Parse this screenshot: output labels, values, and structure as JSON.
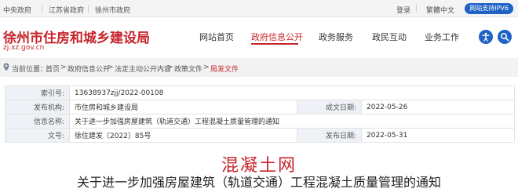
{
  "topbar": {
    "links": [
      "中央政府",
      "江苏省政府",
      "徐州市政府"
    ],
    "login": "登录",
    "language": "繁體中文",
    "ipv6": "网站支持IPV6"
  },
  "header": {
    "title": "徐州市住房和城乡建设局",
    "domain": "zj.xz.gov.cn",
    "nav": [
      {
        "label": "网站首页"
      },
      {
        "label": "政府信息公开"
      },
      {
        "label": "政务服务"
      },
      {
        "label": "政民互动"
      },
      {
        "label": "业务工作"
      }
    ],
    "active_color": "#c6252b",
    "icons": [
      "accessibility-icon",
      "search-icon"
    ]
  },
  "breadcrumb": {
    "prefix": "当前位置：",
    "items": [
      "首页",
      "政府信息公开",
      "法定主动公开内容",
      "政策文件",
      "局发文件"
    ],
    "separator": ">"
  },
  "meta": {
    "index_label": "索引号:",
    "index_value": "13638937zjj/2022-00108",
    "org_label": "发布机构:",
    "org_value": "市住房和城乡建设局",
    "created_label": "成文日期:",
    "created_value": "2022-05-26",
    "name_label": "信息名称:",
    "name_value": "关于进一步加强房屋建筑（轨道交通）工程混凝土质量管理的通知",
    "docno_label": "文号:",
    "docno_value": "徐住建发〔2022〕85号",
    "published_label": "发布日期:",
    "published_value": "2022-05-31"
  },
  "watermark": "混凝土网",
  "document_title": "关于进一步加强房屋建筑（轨道交通）工程混凝土质量管理的通知"
}
